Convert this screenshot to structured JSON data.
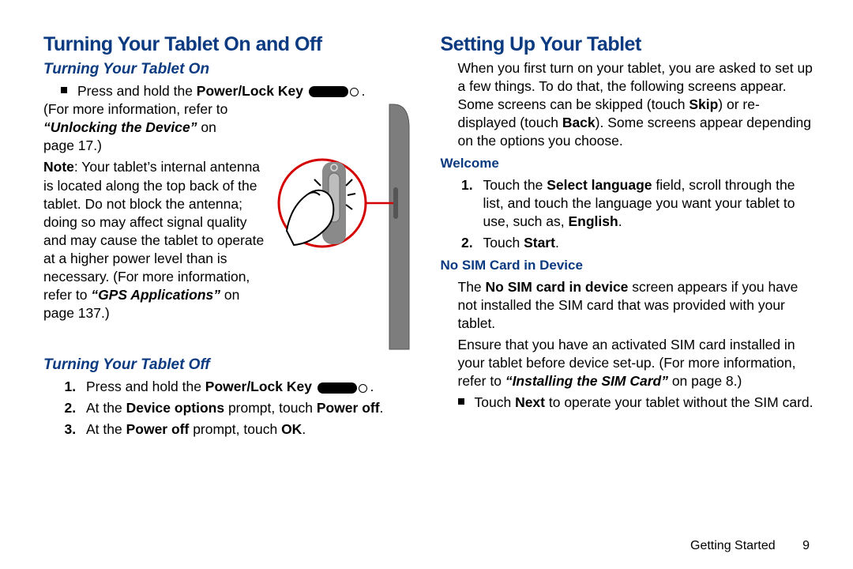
{
  "left": {
    "h1": "Turning Your Tablet On and Off",
    "on": {
      "h2": "Turning Your Tablet On",
      "bullet_pre": "Press and hold the ",
      "bullet_key": "Power/Lock Key",
      "para1": "(For more information, refer to ",
      "para1_link": "“Unlocking the Device”",
      "para1_mid": " on page 17.)",
      "note_lead": "Note",
      "note_body": ": Your tablet’s internal antenna is located along the top back of the tablet. Do not block the antenna; doing so may affect signal quality and may cause the tablet to operate at a higher power level than is necessary. (For more information, refer to ",
      "note_link": "“GPS Applications”",
      "note_tail": " on page 137.)"
    },
    "off": {
      "h2": "Turning Your Tablet Off",
      "s1_pre": "Press and hold the ",
      "s1_key": "Power/Lock Key",
      "s2a": "At the ",
      "s2b": "Device options",
      "s2c": " prompt, touch ",
      "s2d": "Power off",
      "s3a": "At the ",
      "s3b": "Power off",
      "s3c": " prompt, touch ",
      "s3d": "OK"
    }
  },
  "right": {
    "h1": "Setting Up Your Tablet",
    "intro_a": "When you first turn on your tablet, you are asked to set up a few things. To do that, the following screens appear. Some screens can be skipped (touch ",
    "intro_skip": "Skip",
    "intro_b": ") or re-displayed (touch ",
    "intro_back": "Back",
    "intro_c": "). Some screens appear depending on the options you choose.",
    "welcome": {
      "h3": "Welcome",
      "s1a": "Touch the ",
      "s1b": "Select language",
      "s1c": " field, scroll through the list, and touch the language you want your tablet to use, such as, ",
      "s1d": "English",
      "s2a": "Touch ",
      "s2b": "Start"
    },
    "nosim": {
      "h3": "No SIM Card in Device",
      "p1a": "The ",
      "p1b": "No SIM card in device",
      "p1c": " screen appears if you have not installed the SIM card that was provided with your tablet.",
      "p2a": "Ensure that you have an activated SIM card installed in your tablet before device set-up. (For more information, refer to ",
      "p2b": "“Installing the SIM Card”",
      "p2c": " on page 8.)",
      "bul_a": "Touch ",
      "bul_b": "Next",
      "bul_c": " to operate your tablet without the SIM card."
    }
  },
  "footer": {
    "section": "Getting Started",
    "page": "9"
  }
}
